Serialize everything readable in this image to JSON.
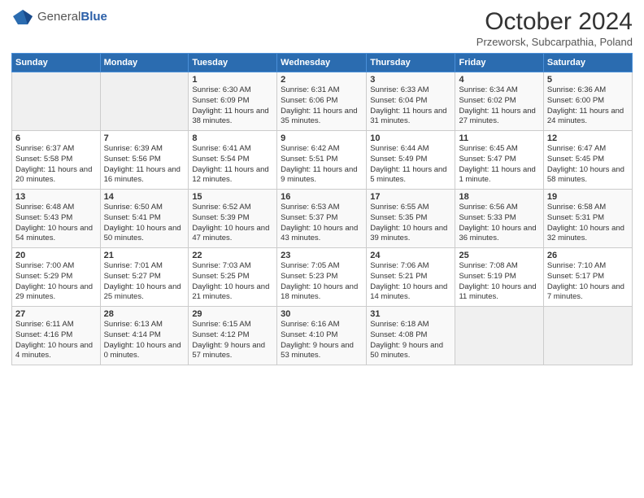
{
  "header": {
    "logo_general": "General",
    "logo_blue": "Blue",
    "title": "October 2024",
    "subtitle": "Przeworsk, Subcarpathia, Poland"
  },
  "weekdays": [
    "Sunday",
    "Monday",
    "Tuesday",
    "Wednesday",
    "Thursday",
    "Friday",
    "Saturday"
  ],
  "weeks": [
    [
      {
        "day": "",
        "sunrise": "",
        "sunset": "",
        "daylight": ""
      },
      {
        "day": "",
        "sunrise": "",
        "sunset": "",
        "daylight": ""
      },
      {
        "day": "1",
        "sunrise": "Sunrise: 6:30 AM",
        "sunset": "Sunset: 6:09 PM",
        "daylight": "Daylight: 11 hours and 38 minutes."
      },
      {
        "day": "2",
        "sunrise": "Sunrise: 6:31 AM",
        "sunset": "Sunset: 6:06 PM",
        "daylight": "Daylight: 11 hours and 35 minutes."
      },
      {
        "day": "3",
        "sunrise": "Sunrise: 6:33 AM",
        "sunset": "Sunset: 6:04 PM",
        "daylight": "Daylight: 11 hours and 31 minutes."
      },
      {
        "day": "4",
        "sunrise": "Sunrise: 6:34 AM",
        "sunset": "Sunset: 6:02 PM",
        "daylight": "Daylight: 11 hours and 27 minutes."
      },
      {
        "day": "5",
        "sunrise": "Sunrise: 6:36 AM",
        "sunset": "Sunset: 6:00 PM",
        "daylight": "Daylight: 11 hours and 24 minutes."
      }
    ],
    [
      {
        "day": "6",
        "sunrise": "Sunrise: 6:37 AM",
        "sunset": "Sunset: 5:58 PM",
        "daylight": "Daylight: 11 hours and 20 minutes."
      },
      {
        "day": "7",
        "sunrise": "Sunrise: 6:39 AM",
        "sunset": "Sunset: 5:56 PM",
        "daylight": "Daylight: 11 hours and 16 minutes."
      },
      {
        "day": "8",
        "sunrise": "Sunrise: 6:41 AM",
        "sunset": "Sunset: 5:54 PM",
        "daylight": "Daylight: 11 hours and 12 minutes."
      },
      {
        "day": "9",
        "sunrise": "Sunrise: 6:42 AM",
        "sunset": "Sunset: 5:51 PM",
        "daylight": "Daylight: 11 hours and 9 minutes."
      },
      {
        "day": "10",
        "sunrise": "Sunrise: 6:44 AM",
        "sunset": "Sunset: 5:49 PM",
        "daylight": "Daylight: 11 hours and 5 minutes."
      },
      {
        "day": "11",
        "sunrise": "Sunrise: 6:45 AM",
        "sunset": "Sunset: 5:47 PM",
        "daylight": "Daylight: 11 hours and 1 minute."
      },
      {
        "day": "12",
        "sunrise": "Sunrise: 6:47 AM",
        "sunset": "Sunset: 5:45 PM",
        "daylight": "Daylight: 10 hours and 58 minutes."
      }
    ],
    [
      {
        "day": "13",
        "sunrise": "Sunrise: 6:48 AM",
        "sunset": "Sunset: 5:43 PM",
        "daylight": "Daylight: 10 hours and 54 minutes."
      },
      {
        "day": "14",
        "sunrise": "Sunrise: 6:50 AM",
        "sunset": "Sunset: 5:41 PM",
        "daylight": "Daylight: 10 hours and 50 minutes."
      },
      {
        "day": "15",
        "sunrise": "Sunrise: 6:52 AM",
        "sunset": "Sunset: 5:39 PM",
        "daylight": "Daylight: 10 hours and 47 minutes."
      },
      {
        "day": "16",
        "sunrise": "Sunrise: 6:53 AM",
        "sunset": "Sunset: 5:37 PM",
        "daylight": "Daylight: 10 hours and 43 minutes."
      },
      {
        "day": "17",
        "sunrise": "Sunrise: 6:55 AM",
        "sunset": "Sunset: 5:35 PM",
        "daylight": "Daylight: 10 hours and 39 minutes."
      },
      {
        "day": "18",
        "sunrise": "Sunrise: 6:56 AM",
        "sunset": "Sunset: 5:33 PM",
        "daylight": "Daylight: 10 hours and 36 minutes."
      },
      {
        "day": "19",
        "sunrise": "Sunrise: 6:58 AM",
        "sunset": "Sunset: 5:31 PM",
        "daylight": "Daylight: 10 hours and 32 minutes."
      }
    ],
    [
      {
        "day": "20",
        "sunrise": "Sunrise: 7:00 AM",
        "sunset": "Sunset: 5:29 PM",
        "daylight": "Daylight: 10 hours and 29 minutes."
      },
      {
        "day": "21",
        "sunrise": "Sunrise: 7:01 AM",
        "sunset": "Sunset: 5:27 PM",
        "daylight": "Daylight: 10 hours and 25 minutes."
      },
      {
        "day": "22",
        "sunrise": "Sunrise: 7:03 AM",
        "sunset": "Sunset: 5:25 PM",
        "daylight": "Daylight: 10 hours and 21 minutes."
      },
      {
        "day": "23",
        "sunrise": "Sunrise: 7:05 AM",
        "sunset": "Sunset: 5:23 PM",
        "daylight": "Daylight: 10 hours and 18 minutes."
      },
      {
        "day": "24",
        "sunrise": "Sunrise: 7:06 AM",
        "sunset": "Sunset: 5:21 PM",
        "daylight": "Daylight: 10 hours and 14 minutes."
      },
      {
        "day": "25",
        "sunrise": "Sunrise: 7:08 AM",
        "sunset": "Sunset: 5:19 PM",
        "daylight": "Daylight: 10 hours and 11 minutes."
      },
      {
        "day": "26",
        "sunrise": "Sunrise: 7:10 AM",
        "sunset": "Sunset: 5:17 PM",
        "daylight": "Daylight: 10 hours and 7 minutes."
      }
    ],
    [
      {
        "day": "27",
        "sunrise": "Sunrise: 6:11 AM",
        "sunset": "Sunset: 4:16 PM",
        "daylight": "Daylight: 10 hours and 4 minutes."
      },
      {
        "day": "28",
        "sunrise": "Sunrise: 6:13 AM",
        "sunset": "Sunset: 4:14 PM",
        "daylight": "Daylight: 10 hours and 0 minutes."
      },
      {
        "day": "29",
        "sunrise": "Sunrise: 6:15 AM",
        "sunset": "Sunset: 4:12 PM",
        "daylight": "Daylight: 9 hours and 57 minutes."
      },
      {
        "day": "30",
        "sunrise": "Sunrise: 6:16 AM",
        "sunset": "Sunset: 4:10 PM",
        "daylight": "Daylight: 9 hours and 53 minutes."
      },
      {
        "day": "31",
        "sunrise": "Sunrise: 6:18 AM",
        "sunset": "Sunset: 4:08 PM",
        "daylight": "Daylight: 9 hours and 50 minutes."
      },
      {
        "day": "",
        "sunrise": "",
        "sunset": "",
        "daylight": ""
      },
      {
        "day": "",
        "sunrise": "",
        "sunset": "",
        "daylight": ""
      }
    ]
  ]
}
